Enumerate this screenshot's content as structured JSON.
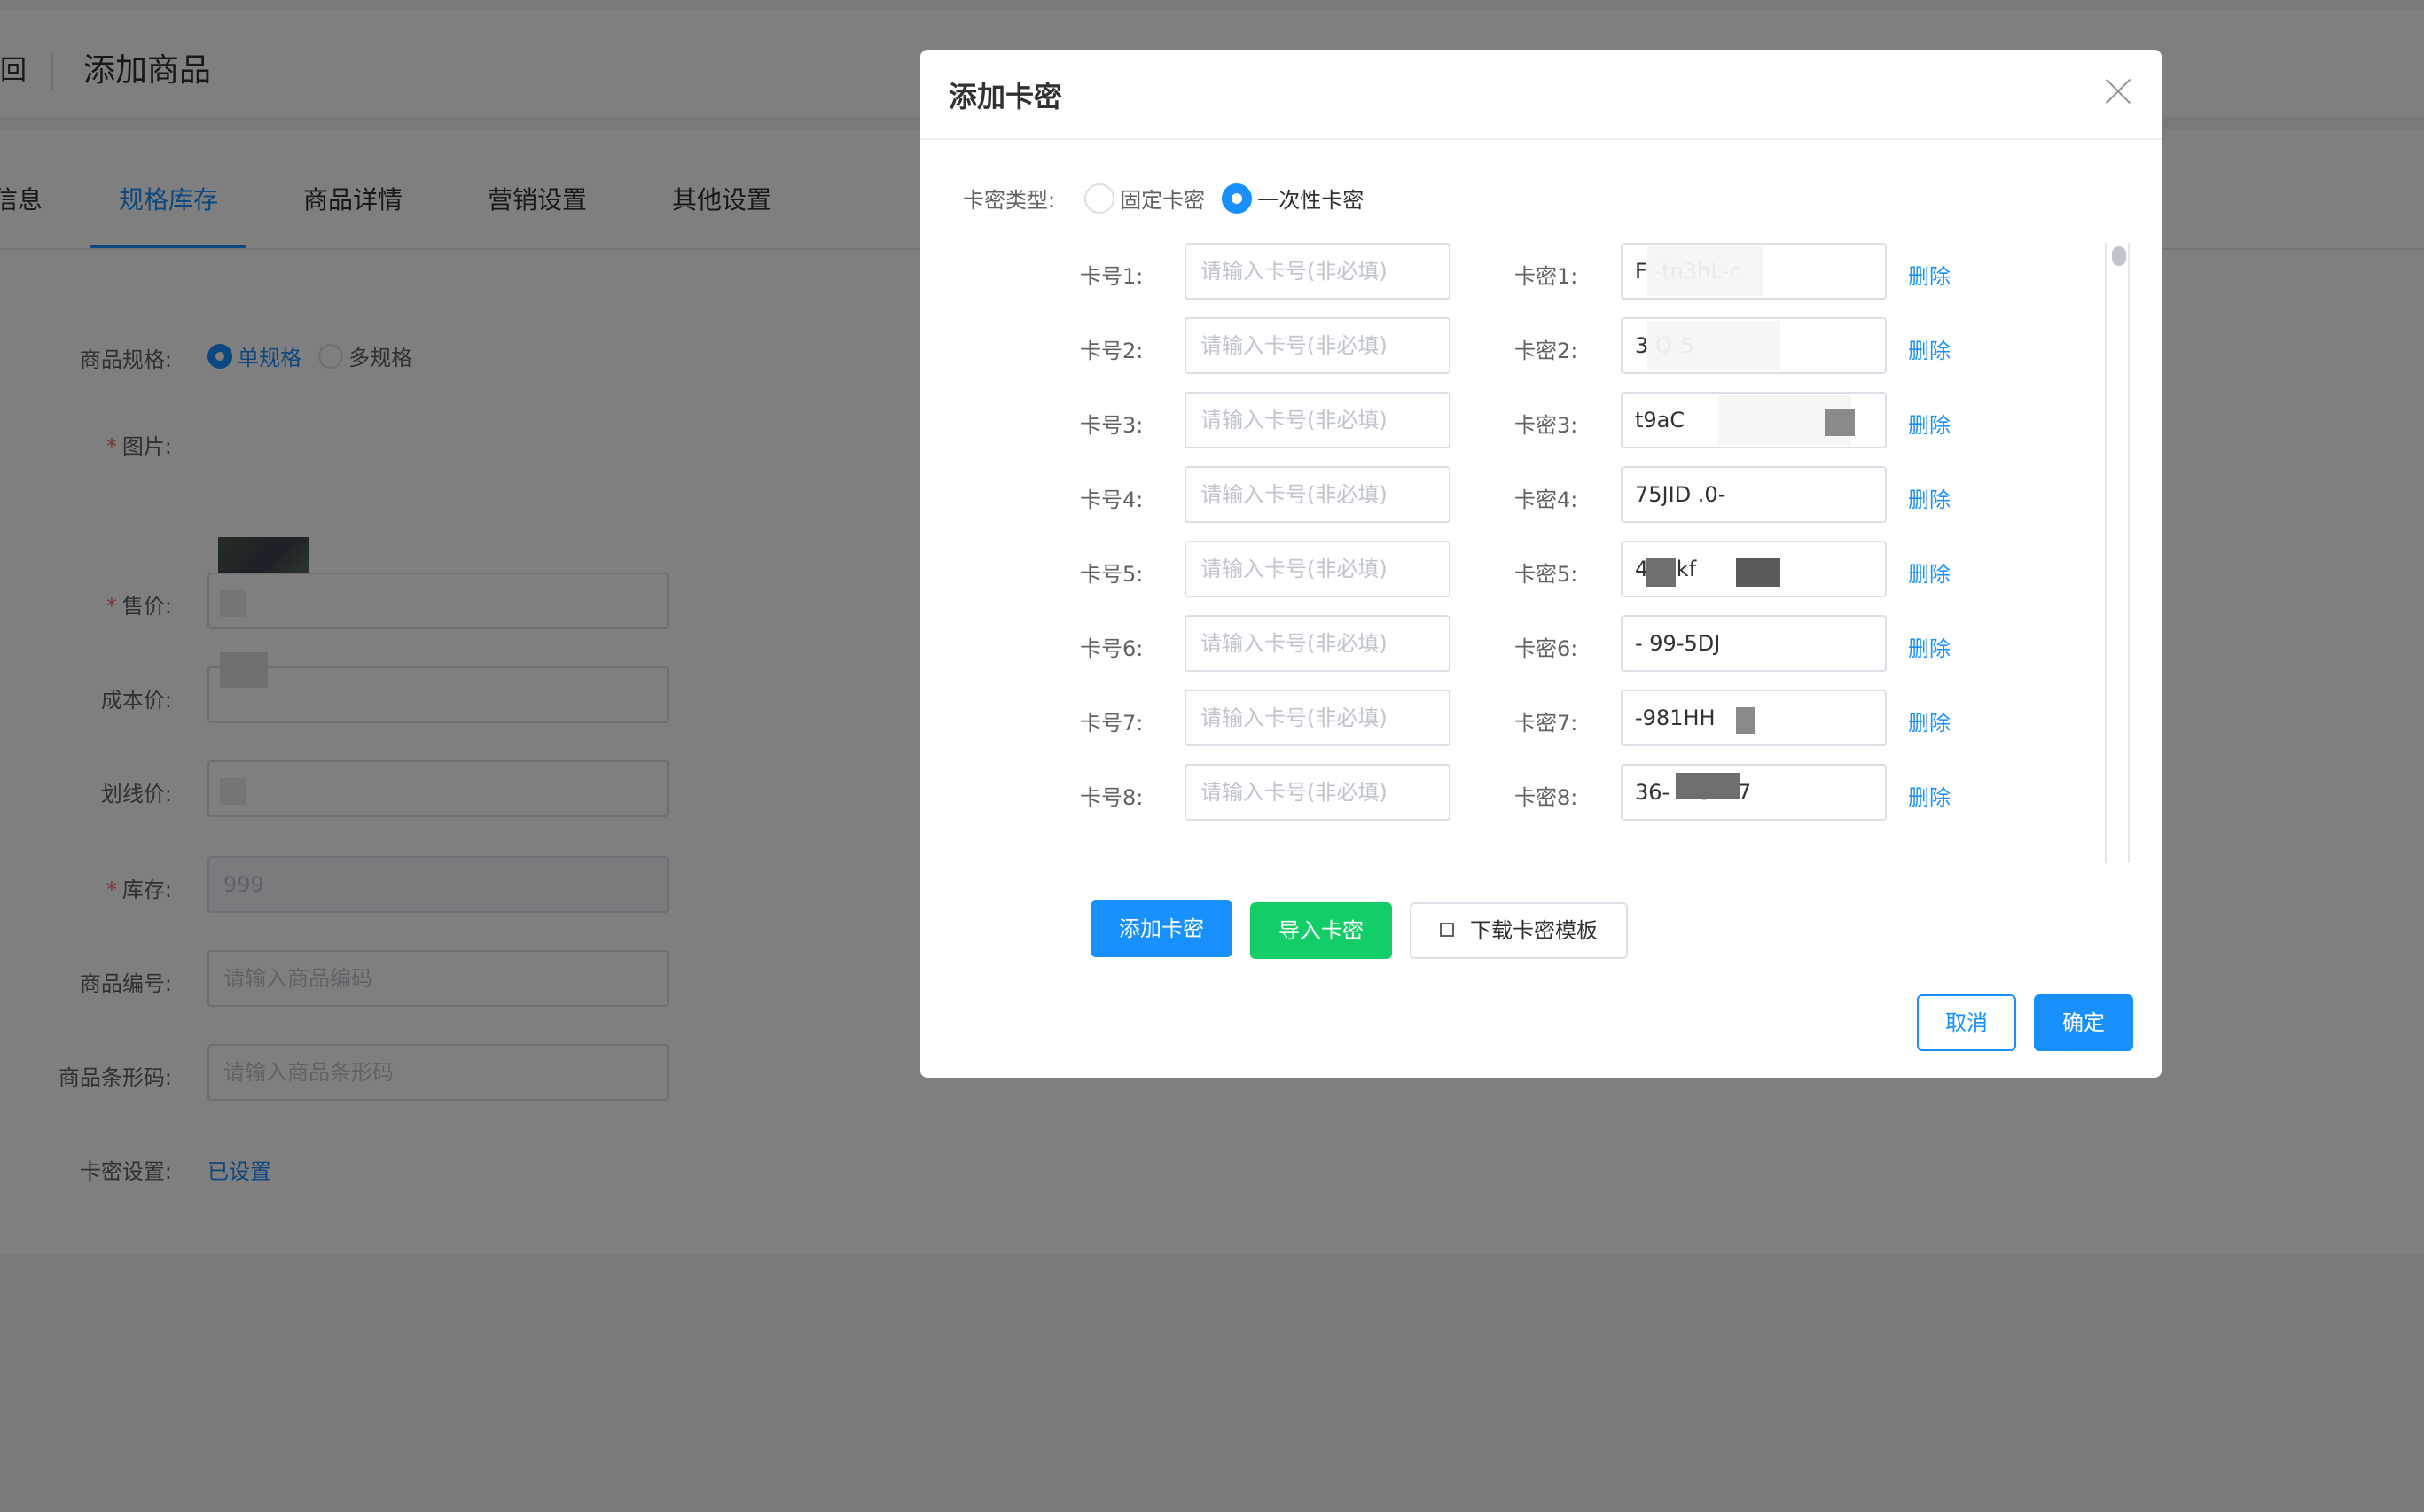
{
  "header": {
    "back_label": "回",
    "title": "添加商品"
  },
  "tabs": [
    {
      "label": "信息"
    },
    {
      "label": "规格库存"
    },
    {
      "label": "商品详情"
    },
    {
      "label": "营销设置"
    },
    {
      "label": "其他设置"
    }
  ],
  "form": {
    "spec_label": "商品规格:",
    "spec_single": "单规格",
    "spec_multi": "多规格",
    "image_label": "图片:",
    "price_label": "售价:",
    "cost_label": "成本价:",
    "strike_label": "划线价:",
    "stock_label": "库存:",
    "stock_value": "999",
    "sku_label": "商品编号:",
    "sku_placeholder": "请输入商品编码",
    "barcode_label": "商品条形码:",
    "barcode_placeholder": "请输入商品条形码",
    "card_setting_label": "卡密设置:",
    "card_setting_link": "已设置",
    "required_mark": "*"
  },
  "dialog": {
    "title": "添加卡密",
    "type_label": "卡密类型:",
    "type_fixed": "固定卡密",
    "type_once": "一次性卡密",
    "card_no_placeholder": "请输入卡号(非必填)",
    "delete_label": "删除",
    "rows": [
      {
        "no_label": "卡号1:",
        "pw_label": "卡密1:",
        "pw_value": "F            -tn3hL-c"
      },
      {
        "no_label": "卡号2:",
        "pw_label": "卡密2:",
        "pw_value": "3              Q-5"
      },
      {
        "no_label": "卡号3:",
        "pw_label": "卡密3:",
        "pw_value": "t9aC"
      },
      {
        "no_label": "卡号4:",
        "pw_label": "卡密4:",
        "pw_value": "75JID              .0-"
      },
      {
        "no_label": "卡号5:",
        "pw_label": "卡密5:",
        "pw_value": "        4-         gkf"
      },
      {
        "no_label": "卡号6:",
        "pw_label": "卡密6:",
        "pw_value": "                 -   99-5DJ"
      },
      {
        "no_label": "卡号7:",
        "pw_label": "卡密7:",
        "pw_value": "                    -981HH"
      },
      {
        "no_label": "卡号8:",
        "pw_label": "卡密8:",
        "pw_value": "         36-         -Z5L27"
      }
    ],
    "add_button": "添加卡密",
    "import_button": "导入卡密",
    "download_button": "下载卡密模板",
    "cancel_button": "取消",
    "confirm_button": "确定"
  },
  "colors": {
    "primary": "#1890ff",
    "success": "#13ce66",
    "danger": "#f56c6c"
  }
}
